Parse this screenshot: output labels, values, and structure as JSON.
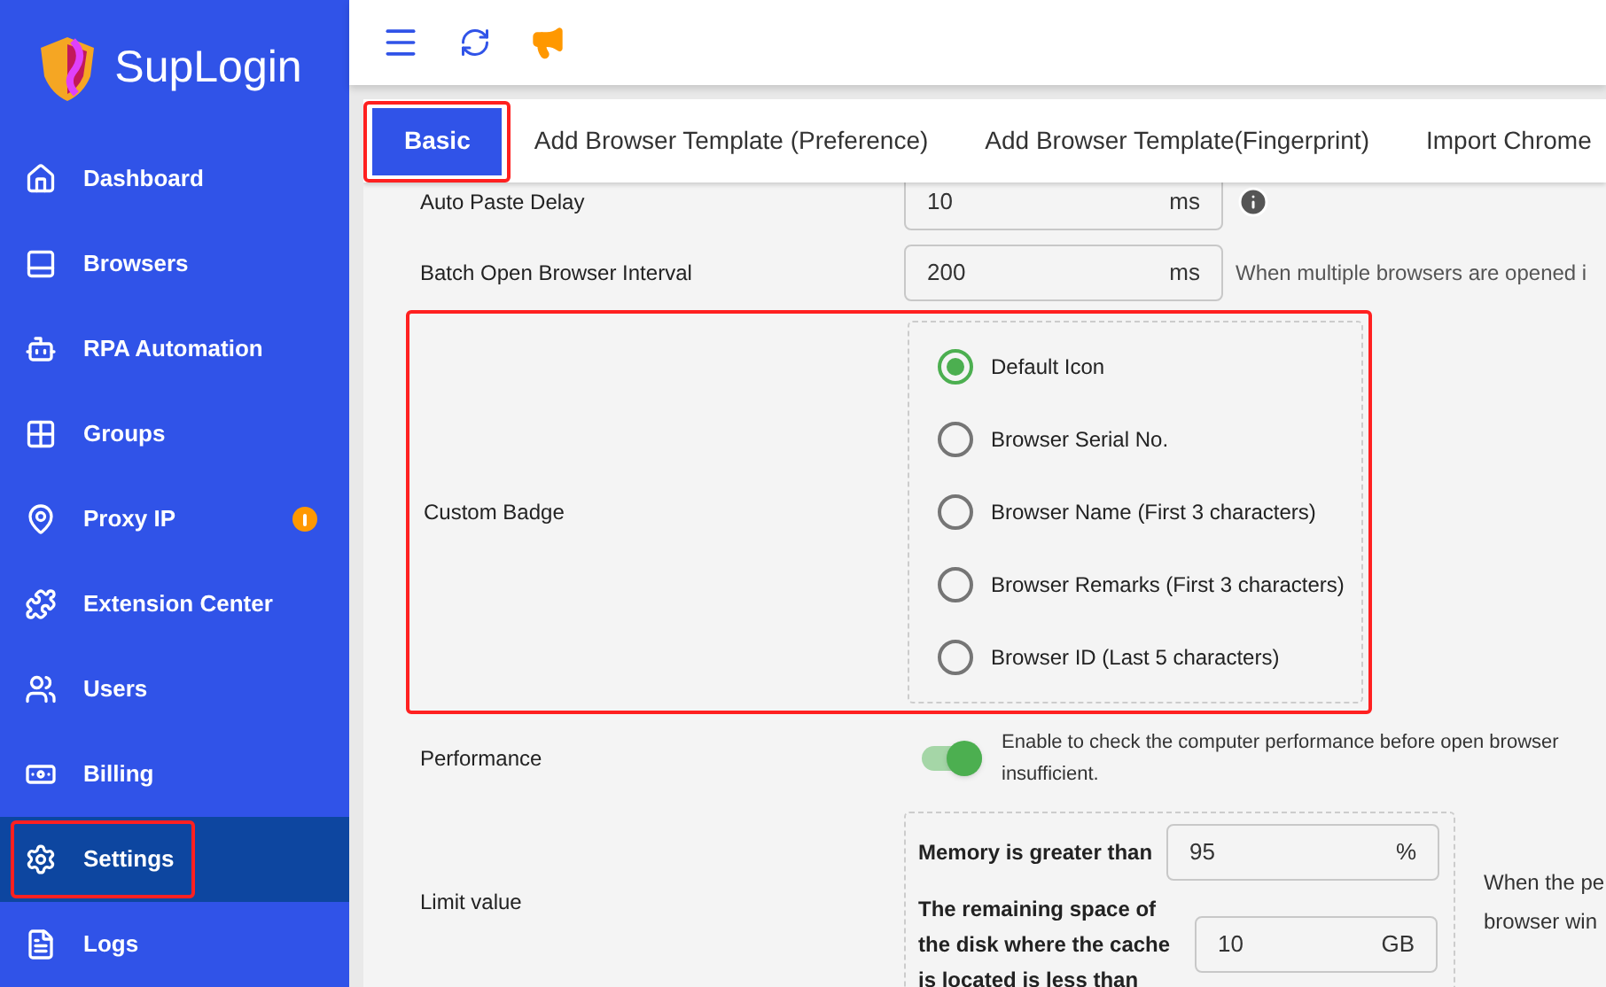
{
  "brand": "SupLogin",
  "sidebar": {
    "items": [
      {
        "label": "Dashboard",
        "selected": false,
        "highlighted": false,
        "alert": false
      },
      {
        "label": "Browsers",
        "selected": false,
        "highlighted": false,
        "alert": false
      },
      {
        "label": "RPA Automation",
        "selected": false,
        "highlighted": false,
        "alert": false
      },
      {
        "label": "Groups",
        "selected": false,
        "highlighted": false,
        "alert": false
      },
      {
        "label": "Proxy IP",
        "selected": false,
        "highlighted": false,
        "alert": true
      },
      {
        "label": "Extension Center",
        "selected": false,
        "highlighted": false,
        "alert": false
      },
      {
        "label": "Users",
        "selected": false,
        "highlighted": false,
        "alert": false
      },
      {
        "label": "Billing",
        "selected": false,
        "highlighted": false,
        "alert": false
      },
      {
        "label": "Settings",
        "selected": true,
        "highlighted": true,
        "alert": false
      },
      {
        "label": "Logs",
        "selected": false,
        "highlighted": false,
        "alert": false
      }
    ]
  },
  "tabs": [
    {
      "label": "Basic",
      "selected": true,
      "highlighted": true
    },
    {
      "label": "Add Browser Template (Preference)",
      "selected": false,
      "highlighted": false
    },
    {
      "label": "Add Browser Template(Fingerprint)",
      "selected": false,
      "highlighted": false
    },
    {
      "label": "Import Chrome",
      "selected": false,
      "highlighted": false
    }
  ],
  "settings": [
    {
      "kind": "number",
      "label": "Auto Paste Delay",
      "value": "10",
      "unit": "ms",
      "info": true
    },
    {
      "kind": "number",
      "label": "Batch Open Browser Interval",
      "value": "200",
      "unit": "ms",
      "info": false,
      "hint": "When multiple browsers are opened i"
    },
    {
      "kind": "radio",
      "label": "Custom Badge",
      "highlighted": true,
      "options": [
        {
          "label": "Default Icon",
          "selected": true
        },
        {
          "label": "Browser Serial No.",
          "selected": false
        },
        {
          "label": "Browser Name (First 3 characters)",
          "selected": false
        },
        {
          "label": "Browser Remarks (First 3 characters)",
          "selected": false
        },
        {
          "label": "Browser ID (Last 5 characters)",
          "selected": false
        }
      ]
    },
    {
      "kind": "switch",
      "label": "Performance",
      "on": true,
      "hint_lines": [
        "Enable to check the computer performance before open browser",
        "insufficient."
      ]
    },
    {
      "kind": "limits",
      "label": "Limit value",
      "fields": [
        {
          "label": "Memory is greater than",
          "value": "95",
          "unit": "%"
        },
        {
          "label": "The remaining space of the disk where the cache is located is less than",
          "value": "10",
          "unit": "GB"
        }
      ],
      "hint_lines": [
        "When the pe",
        "browser win"
      ]
    }
  ]
}
